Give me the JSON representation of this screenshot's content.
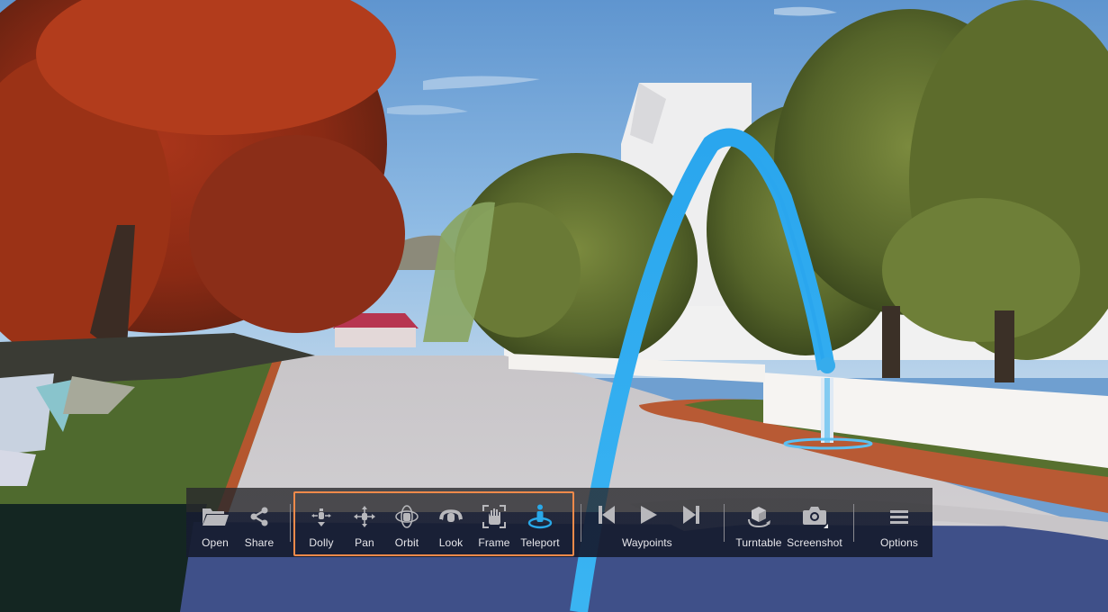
{
  "app": {
    "view": "3D scene viewer - suburban street with teleport arc"
  },
  "toolbar": {
    "file": [
      {
        "id": "open",
        "label": "Open",
        "icon": "folder-icon"
      },
      {
        "id": "share",
        "label": "Share",
        "icon": "share-icon"
      }
    ],
    "navigation": [
      {
        "id": "dolly",
        "label": "Dolly",
        "icon": "dolly-icon",
        "active": false
      },
      {
        "id": "pan",
        "label": "Pan",
        "icon": "pan-icon",
        "active": false
      },
      {
        "id": "orbit",
        "label": "Orbit",
        "icon": "orbit-icon",
        "active": false
      },
      {
        "id": "look",
        "label": "Look",
        "icon": "look-icon",
        "active": false
      },
      {
        "id": "frame",
        "label": "Frame",
        "icon": "frame-icon",
        "active": false
      },
      {
        "id": "teleport",
        "label": "Teleport",
        "icon": "teleport-icon",
        "active": true
      }
    ],
    "waypoints": {
      "label": "Waypoints",
      "controls": [
        {
          "id": "previous",
          "icon": "skip-previous-icon"
        },
        {
          "id": "play",
          "icon": "play-icon"
        },
        {
          "id": "next",
          "icon": "skip-next-icon"
        }
      ]
    },
    "tools": [
      {
        "id": "turntable",
        "label": "Turntable",
        "icon": "turntable-icon"
      },
      {
        "id": "screenshot",
        "label": "Screenshot",
        "icon": "camera-icon",
        "has_menu": true
      }
    ],
    "options": {
      "id": "options",
      "label": "Options",
      "icon": "menu-icon"
    },
    "colors": {
      "icon": "#b8b8bc",
      "active": "#29a8e8",
      "highlight_border": "#f08a4a",
      "label": "#e6e6ea"
    }
  }
}
